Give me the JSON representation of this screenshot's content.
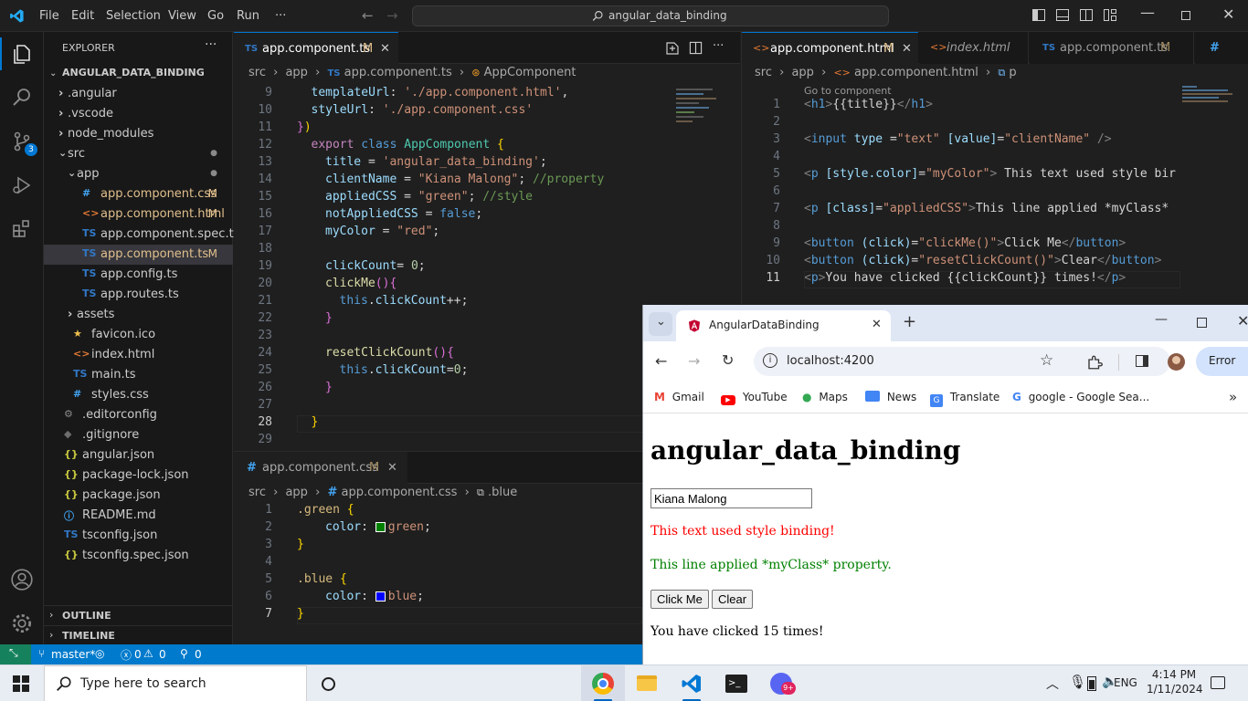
{
  "titlebar": {
    "menus": [
      "File",
      "Edit",
      "Selection",
      "View",
      "Go",
      "Run",
      "···"
    ],
    "search_text": "angular_data_binding"
  },
  "explorer": {
    "header": "EXPLORER",
    "project": "ANGULAR_DATA_BINDING",
    "items": [
      {
        "label": ".angular",
        "depth": 1,
        "kind": "folder-closed"
      },
      {
        "label": ".vscode",
        "depth": 1,
        "kind": "folder-closed"
      },
      {
        "label": "node_modules",
        "depth": 1,
        "kind": "folder-closed"
      },
      {
        "label": "src",
        "depth": 1,
        "kind": "folder-open",
        "badge": "●"
      },
      {
        "label": "app",
        "depth": 2,
        "kind": "folder-open",
        "badge": "●"
      },
      {
        "label": "app.component.css",
        "depth": 3,
        "kind": "css",
        "badge": "M"
      },
      {
        "label": "app.component.html",
        "depth": 3,
        "kind": "html",
        "badge": "M"
      },
      {
        "label": "app.component.spec.ts",
        "depth": 3,
        "kind": "ts"
      },
      {
        "label": "app.component.ts",
        "depth": 3,
        "kind": "ts",
        "badge": "M",
        "selected": true
      },
      {
        "label": "app.config.ts",
        "depth": 3,
        "kind": "ts"
      },
      {
        "label": "app.routes.ts",
        "depth": 3,
        "kind": "ts"
      },
      {
        "label": "assets",
        "depth": 2,
        "kind": "folder-closed"
      },
      {
        "label": "favicon.ico",
        "depth": 2,
        "kind": "star"
      },
      {
        "label": "index.html",
        "depth": 2,
        "kind": "html"
      },
      {
        "label": "main.ts",
        "depth": 2,
        "kind": "ts"
      },
      {
        "label": "styles.css",
        "depth": 2,
        "kind": "css"
      },
      {
        "label": ".editorconfig",
        "depth": 1,
        "kind": "gear"
      },
      {
        "label": ".gitignore",
        "depth": 1,
        "kind": "diamond"
      },
      {
        "label": "angular.json",
        "depth": 1,
        "kind": "json"
      },
      {
        "label": "package-lock.json",
        "depth": 1,
        "kind": "json"
      },
      {
        "label": "package.json",
        "depth": 1,
        "kind": "json"
      },
      {
        "label": "README.md",
        "depth": 1,
        "kind": "info"
      },
      {
        "label": "tsconfig.json",
        "depth": 1,
        "kind": "tsconfig"
      },
      {
        "label": "tsconfig.spec.json",
        "depth": 1,
        "kind": "json"
      }
    ],
    "outline": "OUTLINE",
    "timeline": "TIMELINE"
  },
  "activity": {
    "scm_badge": "3"
  },
  "editor_ts": {
    "tab": {
      "icon": "TS",
      "label": "app.component.ts",
      "badge": "M"
    },
    "breadcrumb": [
      "src",
      "app",
      "app.component.ts",
      "AppComponent"
    ],
    "lines": [
      {
        "n": "9",
        "html": "<span class='prop'>templateUrl</span><span class='punc'>: </span><span class='str'>'./app.component.html'</span><span class='punc'>,</span>",
        "indent": 1
      },
      {
        "n": "10",
        "html": "<span class='prop'>styleUrl</span><span class='punc'>: </span><span class='str'>'./app.component.css'</span>",
        "indent": 1
      },
      {
        "n": "11",
        "html": "<span class='brk1'>}</span><span class='brk2'>)</span>",
        "indent": 0
      },
      {
        "n": "12",
        "html": "<span class='kw2'>export</span> <span class='kw'>class</span> <span class='cls'>AppComponent</span> <span class='brk2'>{</span>",
        "indent": 1
      },
      {
        "n": "13",
        "html": "<span class='prop'>title</span> <span class='punc'>=</span> <span class='str'>'angular_data_binding'</span><span class='punc'>;</span>",
        "indent": 2
      },
      {
        "n": "14",
        "html": "<span class='prop'>clientName</span> <span class='punc'>=</span> <span class='str'>\"Kiana Malong\"</span><span class='punc'>;</span> <span class='cmt'>//property</span>",
        "indent": 2
      },
      {
        "n": "15",
        "html": "<span class='prop'>appliedCSS</span> <span class='punc'>=</span> <span class='str'>\"green\"</span><span class='punc'>;</span> <span class='cmt'>//style</span>",
        "indent": 2
      },
      {
        "n": "16",
        "html": "<span class='prop'>notAppliedCSS</span> <span class='punc'>=</span> <span class='kw'>false</span><span class='punc'>;</span>",
        "indent": 2
      },
      {
        "n": "17",
        "html": "<span class='prop'>myColor</span> <span class='punc'>=</span> <span class='str'>\"red\"</span><span class='punc'>;</span>",
        "indent": 2
      },
      {
        "n": "18",
        "html": "",
        "indent": 2
      },
      {
        "n": "19",
        "html": "<span class='prop'>clickCount</span><span class='punc'>= </span><span class='cmt' style='color:#b5cea8'>0</span><span class='punc'>;</span>",
        "indent": 2
      },
      {
        "n": "20",
        "html": "<span class='fn'>clickMe</span><span class='brk1'>()</span><span class='brk1'>{</span>",
        "indent": 2
      },
      {
        "n": "21",
        "html": "<span class='kw'>this</span><span class='punc'>.</span><span class='prop'>clickCount</span><span class='punc'>++;</span>",
        "indent": 3
      },
      {
        "n": "22",
        "html": "<span class='brk1'>}</span>",
        "indent": 2
      },
      {
        "n": "23",
        "html": "",
        "indent": 2
      },
      {
        "n": "24",
        "html": "<span class='fn'>resetClickCount</span><span class='brk1'>()</span><span class='brk1'>{</span>",
        "indent": 2
      },
      {
        "n": "25",
        "html": "<span class='kw'>this</span><span class='punc'>.</span><span class='prop'>clickCount</span><span class='punc'>=</span><span style='color:#b5cea8'>0</span><span class='punc'>;</span>",
        "indent": 3
      },
      {
        "n": "26",
        "html": "<span class='brk1'>}</span>",
        "indent": 2
      },
      {
        "n": "27",
        "html": "",
        "indent": 2
      },
      {
        "n": "28",
        "html": "<span class='brk2'>}</span>",
        "indent": 1,
        "current": true
      },
      {
        "n": "29",
        "html": "",
        "indent": 0
      }
    ]
  },
  "editor_css": {
    "tab": {
      "label": "app.component.css",
      "badge": "M"
    },
    "breadcrumb": [
      "src",
      "app",
      "app.component.css",
      ".blue"
    ],
    "lines": [
      {
        "n": "1",
        "html": "<span style='color:#d7ba7d'>.green</span> <span class='brk2'>{</span>",
        "indent": 0
      },
      {
        "n": "2",
        "html": "<span class='prop'>color</span><span class='punc'>: </span><span style='display:inline-block;width:11px;height:11px;border:1px solid #fff;background:#008000;vertical-align:middle;margin-right:3px'></span><span class='str'>green</span><span class='punc'>;</span>",
        "indent": 1
      },
      {
        "n": "3",
        "html": "<span class='brk2'>}</span>",
        "indent": 0
      },
      {
        "n": "4",
        "html": "",
        "indent": 0
      },
      {
        "n": "5",
        "html": "<span style='color:#d7ba7d'>.blue</span> <span class='brk2'>{</span>",
        "indent": 0
      },
      {
        "n": "6",
        "html": "<span class='prop'>color</span><span class='punc'>: </span><span style='display:inline-block;width:11px;height:11px;border:1px solid #fff;background:#0000ff;vertical-align:middle;margin-right:3px'></span><span class='str'>blue</span><span class='punc'>;</span>",
        "indent": 1
      },
      {
        "n": "7",
        "html": "<span class='brk2'>}</span>",
        "indent": 0,
        "current": true
      }
    ]
  },
  "editor_html": {
    "tabs": [
      {
        "label": "app.component.html",
        "badge": "M",
        "active": true
      },
      {
        "label": "index.html",
        "italic": true
      },
      {
        "label": "app.component.ts",
        "badge": "M"
      },
      {
        "label": "#"
      }
    ],
    "breadcrumb": [
      "src",
      "app",
      "app.component.html",
      "p"
    ],
    "codelens": "Go to component",
    "lines": [
      {
        "n": "1",
        "html": "<span class='tagp'>&lt;</span><span class='tag'>h1</span><span class='tagp'>&gt;</span><span class='txt'>{{title}}</span><span class='tagp'>&lt;/</span><span class='tag'>h1</span><span class='tagp'>&gt;</span>"
      },
      {
        "n": "2",
        "html": ""
      },
      {
        "n": "3",
        "html": "<span class='tagp'>&lt;</span><span class='tag'>input</span> <span class='attr'>type</span> <span class='punc'>=</span><span class='str'>\"text\"</span> <span class='attr'>[value]</span><span class='punc'>=</span><span class='str'>\"clientName\"</span> <span class='tagp'>/&gt;</span>"
      },
      {
        "n": "4",
        "html": ""
      },
      {
        "n": "5",
        "html": "<span class='tagp'>&lt;</span><span class='tag'>p</span> <span class='attr'>[style.color]</span><span class='punc'>=</span><span class='str'>\"myColor\"</span><span class='tagp'>&gt;</span> <span class='txt'>This text used style bir</span>"
      },
      {
        "n": "6",
        "html": ""
      },
      {
        "n": "7",
        "html": "<span class='tagp'>&lt;</span><span class='tag'>p</span> <span class='attr'>[class]</span><span class='punc'>=</span><span class='str'>\"appliedCSS\"</span><span class='tagp'>&gt;</span><span class='txt'>This line applied *myClass*</span>"
      },
      {
        "n": "8",
        "html": ""
      },
      {
        "n": "9",
        "html": "<span class='tagp'>&lt;</span><span class='tag'>button</span> <span class='attr'>(click)</span><span class='punc'>=</span><span class='str'>\"clickMe()\"</span><span class='tagp'>&gt;</span><span class='txt'>Click Me</span><span class='tagp'>&lt;/</span><span class='tag'>button</span><span class='tagp'>&gt;</span>"
      },
      {
        "n": "10",
        "html": "<span class='tagp'>&lt;</span><span class='tag'>button</span> <span class='attr'>(click)</span><span class='punc'>=</span><span class='str'>\"resetClickCount()\"</span><span class='tagp'>&gt;</span><span class='txt'>Clear</span><span class='tagp'>&lt;/</span><span class='tag'>button</span><span class='tagp'>&gt;</span>"
      },
      {
        "n": "11",
        "html": "<span class='tagp'>&lt;</span><span class='tag'>p</span><span class='tagp'>&gt;</span><span class='txt'>You have clicked {{clickCount}} times!</span><span class='tagp'>&lt;/</span><span class='tag'>p</span><span class='tagp'>&gt;</span>",
        "current": true
      }
    ]
  },
  "statusbar": {
    "branch": "master*",
    "errors": "0",
    "warnings": "0",
    "ports": "0"
  },
  "browser": {
    "tab_title": "AngularDataBinding",
    "url": "localhost:4200",
    "profile_btn": "Error",
    "bookmarks": [
      "Gmail",
      "YouTube",
      "Maps",
      "News",
      "Translate",
      "google - Google Sea..."
    ],
    "page": {
      "heading": "angular_data_binding",
      "input_value": "Kiana Malong",
      "red_text": "This text used style binding!",
      "green_text": "This line applied *myClass* property.",
      "btn_click": "Click Me",
      "btn_clear": "Clear",
      "count_text": "You have clicked 15 times!"
    }
  },
  "taskbar": {
    "search_placeholder": "Type here to search",
    "lang": "ENG",
    "time": "4:14 PM",
    "date": "1/11/2024",
    "discord_badge": "9+"
  },
  "colors": {
    "accent": "#007acc",
    "red_text": "#ff0000",
    "green_text": "#008000"
  }
}
